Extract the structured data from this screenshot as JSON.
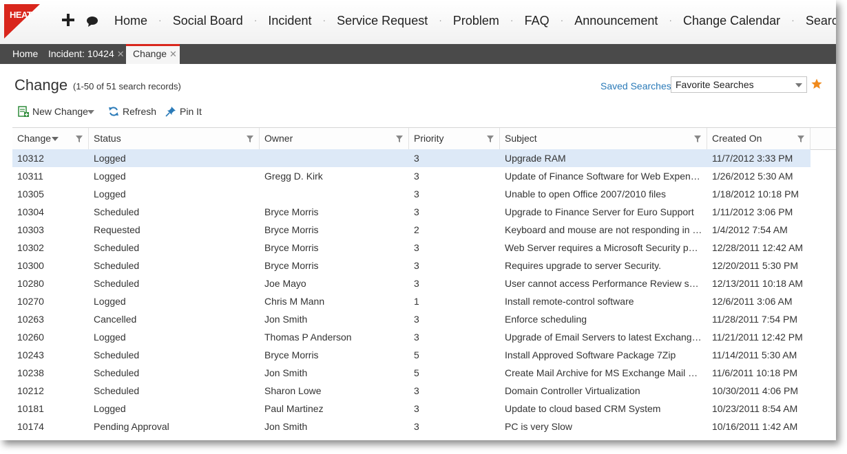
{
  "nav": {
    "logo_text": "HEAT",
    "brand_color": "#d9261c",
    "items": [
      "Home",
      "Social Board",
      "Incident",
      "Service Request",
      "Problem",
      "FAQ",
      "Announcement",
      "Change Calendar",
      "Search"
    ]
  },
  "tabs": [
    {
      "label": "Home",
      "closable": false
    },
    {
      "label": "Incident: 10424",
      "closable": true
    },
    {
      "label": "Change",
      "closable": true,
      "active": true
    }
  ],
  "tab_close_glyph": "✕",
  "page": {
    "title": "Change",
    "record_count": "(1-50 of 51 search records)",
    "saved_searches": "Saved Searches",
    "favorite_searches": "Favorite Searches"
  },
  "toolbar": {
    "new_change": "New Change",
    "refresh": "Refresh",
    "pin_it": "Pin It"
  },
  "grid": {
    "columns": [
      "Change",
      "Status",
      "Owner",
      "Priority",
      "Subject",
      "Created On"
    ],
    "rows": [
      [
        "10312",
        "Logged",
        "",
        "3",
        "Upgrade RAM",
        "11/7/2012 3:33 PM"
      ],
      [
        "10311",
        "Logged",
        "Gregg D. Kirk",
        "3",
        "Update of Finance Software for Web Expense …",
        "1/26/2012 5:30 AM"
      ],
      [
        "10305",
        "Logged",
        "",
        "3",
        "Unable to open Office 2007/2010 files",
        "1/18/2012 10:18 PM"
      ],
      [
        "10304",
        "Scheduled",
        "Bryce Morris",
        "3",
        "Upgrade to Finance Server for Euro Support",
        "1/11/2012 3:06 PM"
      ],
      [
        "10303",
        "Requested",
        "Bryce Morris",
        "2",
        "Keyboard and mouse are not responding in citrix",
        "1/4/2012 7:54 AM"
      ],
      [
        "10302",
        "Scheduled",
        "Bryce Morris",
        "3",
        "Web Server requires a Microsoft Security patch…",
        "12/28/2011 12:42 AM"
      ],
      [
        "10300",
        "Scheduled",
        "Bryce Morris",
        "3",
        "Requires upgrade to server Security.",
        "12/20/2011 5:30 PM"
      ],
      [
        "10280",
        "Scheduled",
        "Joe Mayo",
        "3",
        "User cannot access Performance Review system",
        "12/13/2011 10:18 AM"
      ],
      [
        "10270",
        "Logged",
        "Chris M Mann",
        "1",
        "Install remote-control software",
        "12/6/2011 3:06 AM"
      ],
      [
        "10263",
        "Cancelled",
        "Jon Smith",
        "3",
        "Enforce scheduling",
        "11/28/2011 7:54 PM"
      ],
      [
        "10260",
        "Logged",
        "Thomas P Anderson",
        "3",
        "Upgrade of Email Servers to latest Exchange S…",
        "11/21/2011 12:42 PM"
      ],
      [
        "10243",
        "Scheduled",
        "Bryce Morris",
        "5",
        "Install Approved Software Package 7Zip",
        "11/14/2011 5:30 AM"
      ],
      [
        "10238",
        "Scheduled",
        "Jon Smith",
        "5",
        "Create Mail Archive for MS Exchange Mail Folder",
        "11/6/2011 10:18 PM"
      ],
      [
        "10212",
        "Scheduled",
        "Sharon Lowe",
        "3",
        "Domain Controller Virtualization",
        "10/30/2011 4:06 PM"
      ],
      [
        "10181",
        "Logged",
        "Paul Martinez",
        "3",
        "Update to cloud based CRM System",
        "10/23/2011 8:54 AM"
      ],
      [
        "10174",
        "Pending Approval",
        "Jon Smith",
        "3",
        "PC is very Slow",
        "10/16/2011 1:42 AM"
      ]
    ]
  }
}
